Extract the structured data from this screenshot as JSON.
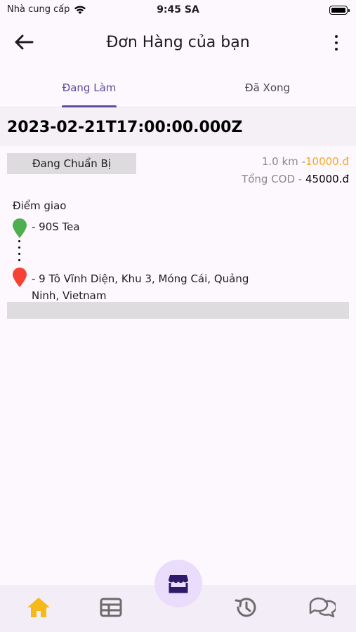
{
  "status_bar": {
    "carrier": "Nhà cung cấp",
    "time": "9:45 SA"
  },
  "header": {
    "title": "Đơn Hàng của bạn",
    "back_icon": "arrow-left-icon",
    "menu_icon": "more-vertical-icon"
  },
  "tabs": [
    {
      "label": "Đang Làm",
      "active": true
    },
    {
      "label": "Đã Xong",
      "active": false
    }
  ],
  "order": {
    "date": "2023-02-21T17:00:00.000Z",
    "status": "Đang Chuẩn Bị",
    "distance": "1.0 km -",
    "shipping_fee": "10000.đ",
    "cod_label": "Tổng COD -",
    "cod_amount": "45000.đ",
    "points_label": "Điểm giao",
    "pickup": "- 90S Tea",
    "dropoff": "- 9 Tô Vĩnh Diện, Khu 3, Móng Cái, Quảng Ninh, Vietnam"
  },
  "bottom_nav": {
    "items": [
      {
        "icon": "home-icon",
        "active": true
      },
      {
        "icon": "table-icon",
        "active": false
      },
      {
        "icon": "store-icon",
        "active": true
      },
      {
        "icon": "history-icon",
        "active": false
      },
      {
        "icon": "chat-icon",
        "active": false
      }
    ]
  },
  "colors": {
    "accent": "#5b4a9e",
    "fee": "#f5a623",
    "home_active": "#f6b91a",
    "pickup_pin": "#4caf50",
    "dropoff_pin": "#f44336"
  }
}
